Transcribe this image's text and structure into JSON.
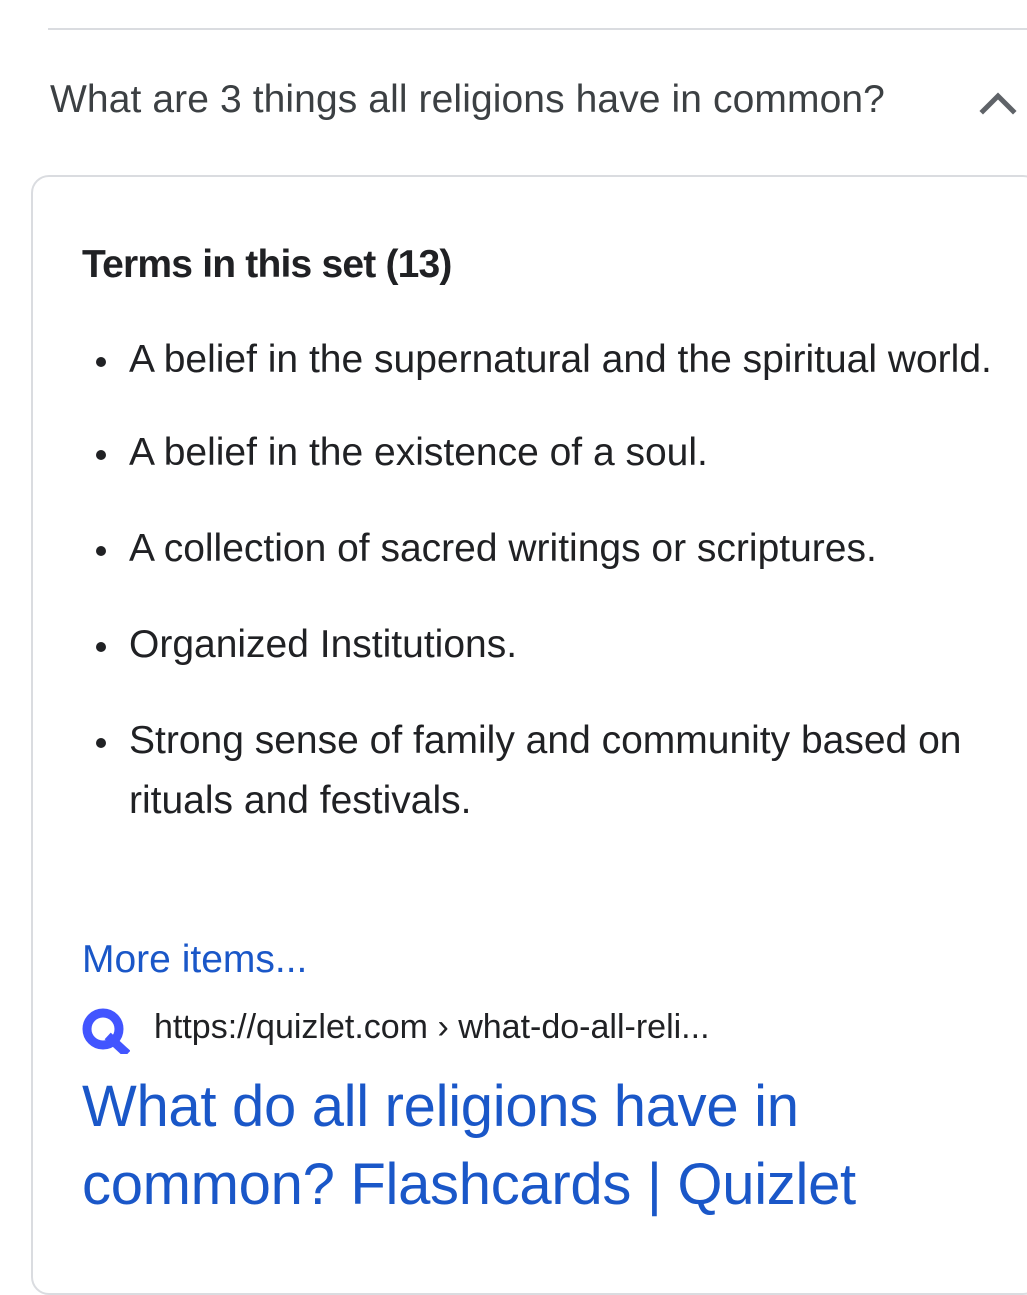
{
  "faq": {
    "question": "What are 3 things all religions have in common?",
    "expand_icon": "chevron-up-icon"
  },
  "answer": {
    "heading": "Terms in this set (13)",
    "items": [
      "A belief in the supernatural and the spiritual world.",
      "A belief in the existence of a soul.",
      "A collection of sacred writings or scriptures.",
      "Organized Institutions.",
      "Strong sense of family and community based on rituals and festivals."
    ],
    "more_link": "More items..."
  },
  "source": {
    "favicon": "quizlet-logo-icon",
    "url": "https://quizlet.com › what-do-all-reli...",
    "title": "What do all religions have in common? Flashcards | Quizlet"
  },
  "colors": {
    "link": "#1a57c8",
    "text": "#202124",
    "border": "#dadce0",
    "favicon": "#4255ff"
  }
}
